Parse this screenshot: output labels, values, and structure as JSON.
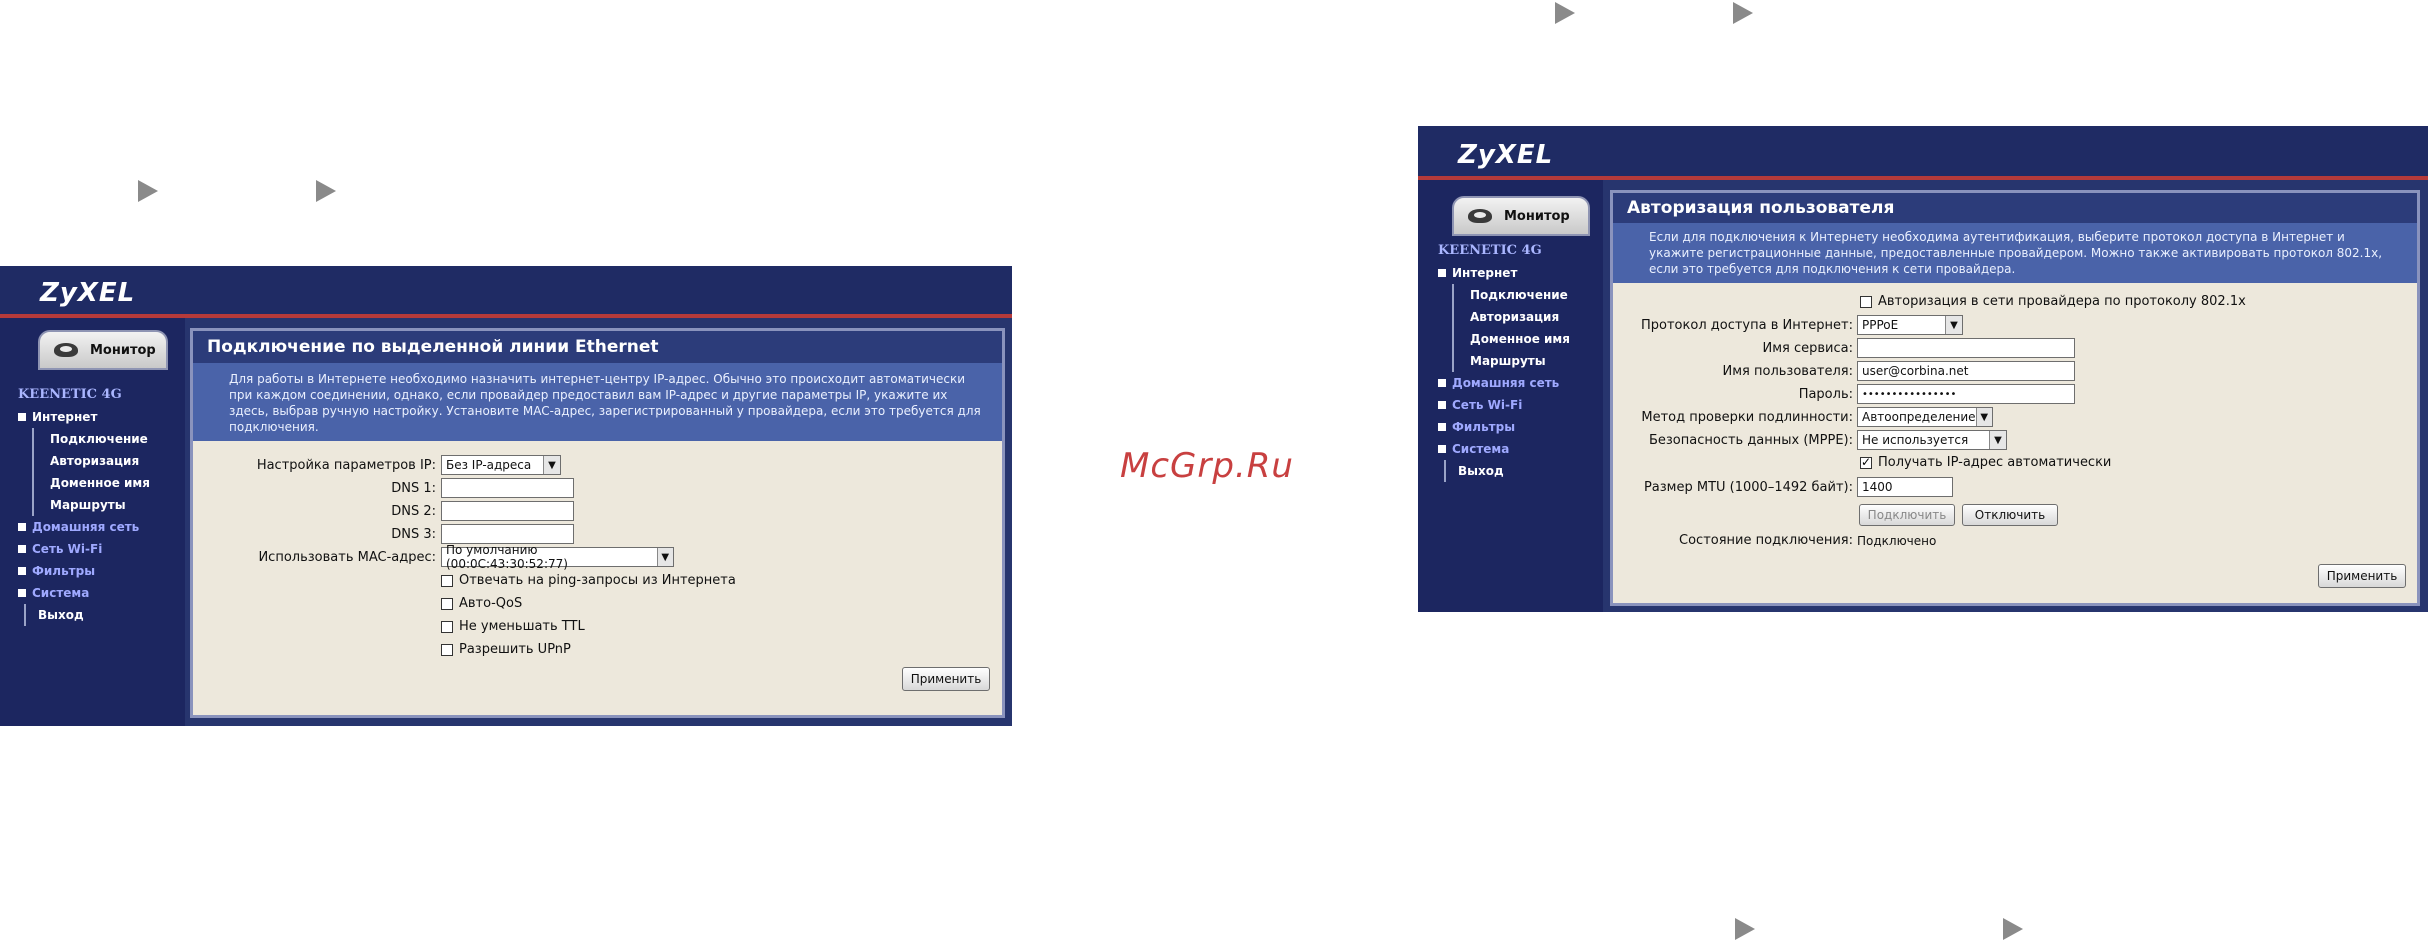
{
  "watermark": "McGrp.Ru",
  "common": {
    "logo": "ZyXEL",
    "monitor_tab": "Монитор",
    "brand": "KEENETIC 4G",
    "nav": {
      "internet": "Интернет",
      "connection": "Подключение",
      "authorization": "Авторизация",
      "domain_name": "Доменное имя",
      "routes": "Маршруты",
      "home_network": "Домашняя сеть",
      "wifi": "Сеть Wi-Fi",
      "filters": "Фильтры",
      "system": "Система",
      "logout": "Выход"
    },
    "apply": "Применить"
  },
  "left": {
    "title": "Подключение по выделенной линии Ethernet",
    "description": "Для работы в Интернете необходимо назначить интернет-центру IP-адрес. Обычно это происходит автоматически при каждом соединении, однако, если провайдер предоставил вам IP-адрес и другие параметры IP, укажите их здесь, выбрав ручную настройку. Установите MAC-адрес, зарегистрированный у провайдера, если это требуется для подключения.",
    "ip_settings_label": "Настройка параметров IP:",
    "ip_settings_value": "Без IP-адреса",
    "dns1_label": "DNS 1:",
    "dns2_label": "DNS 2:",
    "dns3_label": "DNS 3:",
    "mac_label": "Использовать MAC-адрес:",
    "mac_value": "По умолчанию (00:0C:43:30:52:77)",
    "ping_label": "Отвечать на ping-запросы из Интернета",
    "qos_label": "Авто-QoS",
    "ttl_label": "Не уменьшать TTL",
    "upnp_label": "Разрешить UPnP"
  },
  "right": {
    "title": "Авторизация пользователя",
    "description": "Если для подключения к Интернету необходима аутентификация, выберите протокол доступа в Интернет и укажите регистрационные данные, предоставленные провайдером. Можно также активировать протокол 802.1x, если это требуется для подключения к сети провайдера.",
    "auth8021x_label": "Авторизация в сети провайдера по протоколу 802.1x",
    "protocol_label": "Протокол доступа в Интернет:",
    "protocol_value": "PPPoE",
    "service_label": "Имя сервиса:",
    "service_value": "",
    "username_label": "Имя пользователя:",
    "username_value": "user@corbina.net",
    "password_label": "Пароль:",
    "password_value": "••••••••••••••••",
    "auth_method_label": "Метод проверки подлинности:",
    "auth_method_value": "Автоопределение",
    "security_label": "Безопасность данных (MPPE):",
    "security_value": "Не используется",
    "auto_ip_label": "Получать IP-адрес автоматически",
    "mtu_label": "Размер MTU (1000–1492 байт):",
    "mtu_value": "1400",
    "connect_button": "Подключить",
    "disconnect_button": "Отключить",
    "status_label": "Состояние подключения:",
    "status_value": "Подключено"
  }
}
